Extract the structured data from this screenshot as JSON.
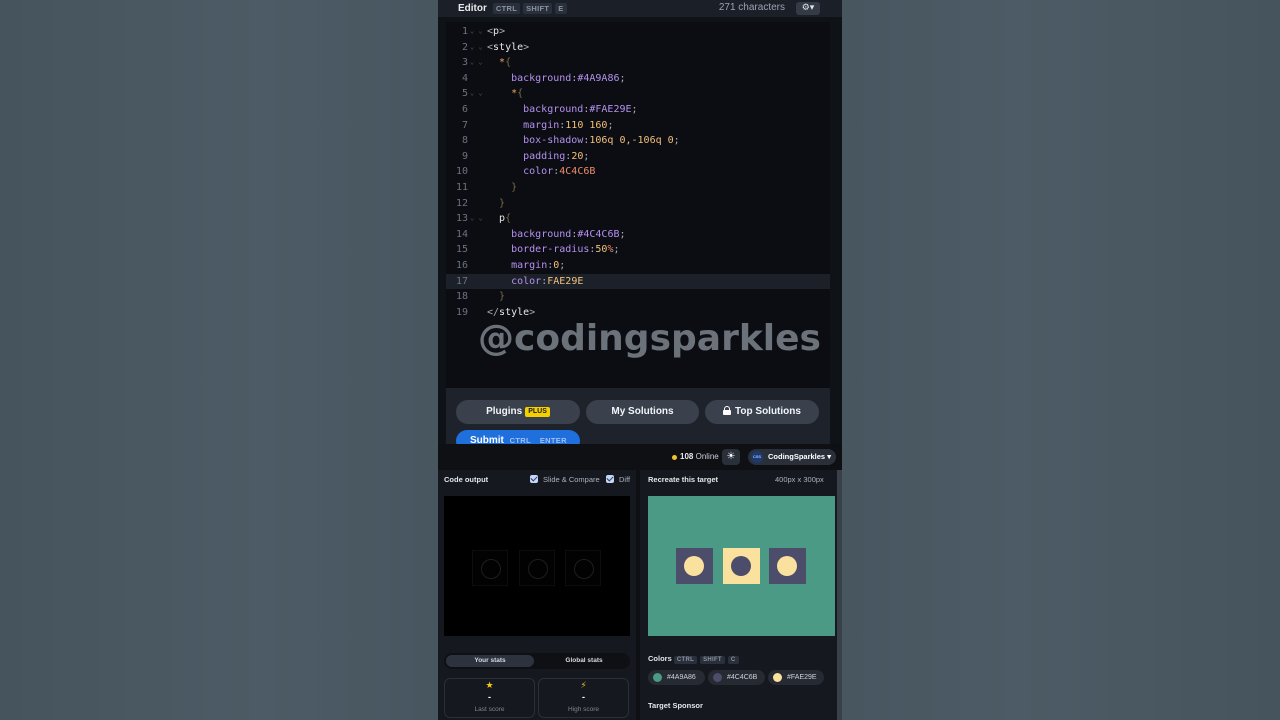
{
  "editor": {
    "title": "Editor",
    "shortcut": [
      "CTRL",
      "SHIFT",
      "E"
    ],
    "char_count": "271 characters",
    "settings_icon": "gear-icon"
  },
  "code_lines": [
    {
      "n": "1",
      "fold": true,
      "tokens": [
        {
          "c": "t-punc",
          "t": "<"
        },
        {
          "c": "t-tag",
          "t": "p"
        },
        {
          "c": "t-punc",
          "t": ">"
        }
      ]
    },
    {
      "n": "2",
      "fold": true,
      "tokens": [
        {
          "c": "t-punc",
          "t": "<"
        },
        {
          "c": "t-tag",
          "t": "style"
        },
        {
          "c": "t-punc",
          "t": ">"
        }
      ]
    },
    {
      "n": "3",
      "fold": true,
      "tokens": [
        {
          "c": "t-punc",
          "t": "  "
        },
        {
          "c": "t-sel",
          "t": "*"
        },
        {
          "c": "t-brace",
          "t": "{"
        }
      ]
    },
    {
      "n": "4",
      "fold": false,
      "tokens": [
        {
          "c": "t-punc",
          "t": "    "
        },
        {
          "c": "t-prop",
          "t": "background"
        },
        {
          "c": "t-punc",
          "t": ":"
        },
        {
          "c": "t-prop",
          "t": "#4A9A86"
        },
        {
          "c": "t-punc",
          "t": ";"
        }
      ]
    },
    {
      "n": "5",
      "fold": true,
      "tokens": [
        {
          "c": "t-punc",
          "t": "    "
        },
        {
          "c": "t-sel",
          "t": "*"
        },
        {
          "c": "t-brace",
          "t": "{"
        }
      ]
    },
    {
      "n": "6",
      "fold": false,
      "tokens": [
        {
          "c": "t-punc",
          "t": "      "
        },
        {
          "c": "t-prop",
          "t": "background"
        },
        {
          "c": "t-punc",
          "t": ":"
        },
        {
          "c": "t-prop",
          "t": "#FAE29E"
        },
        {
          "c": "t-punc",
          "t": ";"
        }
      ]
    },
    {
      "n": "7",
      "fold": false,
      "tokens": [
        {
          "c": "t-punc",
          "t": "      "
        },
        {
          "c": "t-prop",
          "t": "margin"
        },
        {
          "c": "t-punc",
          "t": ":"
        },
        {
          "c": "t-val",
          "t": "110 160"
        },
        {
          "c": "t-punc",
          "t": ";"
        }
      ]
    },
    {
      "n": "8",
      "fold": false,
      "tokens": [
        {
          "c": "t-punc",
          "t": "      "
        },
        {
          "c": "t-prop",
          "t": "box-shadow"
        },
        {
          "c": "t-punc",
          "t": ":"
        },
        {
          "c": "t-val",
          "t": "106q 0,-106q 0"
        },
        {
          "c": "t-punc",
          "t": ";"
        }
      ]
    },
    {
      "n": "9",
      "fold": false,
      "tokens": [
        {
          "c": "t-punc",
          "t": "      "
        },
        {
          "c": "t-prop",
          "t": "padding"
        },
        {
          "c": "t-punc",
          "t": ":"
        },
        {
          "c": "t-val",
          "t": "20"
        },
        {
          "c": "t-punc",
          "t": ";"
        }
      ]
    },
    {
      "n": "10",
      "fold": false,
      "tokens": [
        {
          "c": "t-punc",
          "t": "      "
        },
        {
          "c": "t-prop",
          "t": "color"
        },
        {
          "c": "t-punc",
          "t": ":"
        },
        {
          "c": "t-pct",
          "t": "4C4C6B"
        }
      ]
    },
    {
      "n": "11",
      "fold": false,
      "tokens": [
        {
          "c": "t-punc",
          "t": "    "
        },
        {
          "c": "t-brace",
          "t": "}"
        }
      ]
    },
    {
      "n": "12",
      "fold": false,
      "tokens": [
        {
          "c": "t-punc",
          "t": "  "
        },
        {
          "c": "t-brace",
          "t": "}"
        }
      ]
    },
    {
      "n": "13",
      "fold": true,
      "tokens": [
        {
          "c": "t-punc",
          "t": "  "
        },
        {
          "c": "t-tag",
          "t": "p"
        },
        {
          "c": "t-brace",
          "t": "{"
        }
      ]
    },
    {
      "n": "14",
      "fold": false,
      "tokens": [
        {
          "c": "t-punc",
          "t": "    "
        },
        {
          "c": "t-prop",
          "t": "background"
        },
        {
          "c": "t-punc",
          "t": ":"
        },
        {
          "c": "t-prop",
          "t": "#4C4C6B"
        },
        {
          "c": "t-punc",
          "t": ";"
        }
      ]
    },
    {
      "n": "15",
      "fold": false,
      "tokens": [
        {
          "c": "t-punc",
          "t": "    "
        },
        {
          "c": "t-prop",
          "t": "border-radius"
        },
        {
          "c": "t-punc",
          "t": ":"
        },
        {
          "c": "t-val",
          "t": "50"
        },
        {
          "c": "t-pct",
          "t": "%"
        },
        {
          "c": "t-punc",
          "t": ";"
        }
      ]
    },
    {
      "n": "16",
      "fold": false,
      "tokens": [
        {
          "c": "t-punc",
          "t": "    "
        },
        {
          "c": "t-prop",
          "t": "margin"
        },
        {
          "c": "t-punc",
          "t": ":"
        },
        {
          "c": "t-val",
          "t": "0"
        },
        {
          "c": "t-punc",
          "t": ";"
        }
      ]
    },
    {
      "n": "17",
      "fold": false,
      "active": true,
      "tokens": [
        {
          "c": "t-punc",
          "t": "    "
        },
        {
          "c": "t-prop",
          "t": "color"
        },
        {
          "c": "t-punc",
          "t": ":"
        },
        {
          "c": "t-val",
          "t": "FAE29E"
        }
      ]
    },
    {
      "n": "18",
      "fold": false,
      "tokens": [
        {
          "c": "t-punc",
          "t": "  "
        },
        {
          "c": "t-brace",
          "t": "}"
        }
      ]
    },
    {
      "n": "19",
      "fold": false,
      "tokens": [
        {
          "c": "t-punc",
          "t": "</"
        },
        {
          "c": "t-tag",
          "t": "style"
        },
        {
          "c": "t-punc",
          "t": ">"
        }
      ]
    }
  ],
  "watermark": "@codingsparkles",
  "buttons": {
    "plugins": "Plugins",
    "plus_badge": "PLUS",
    "my_solutions": "My Solutions",
    "top_solutions": "Top Solutions",
    "submit": "Submit",
    "submit_shortcut": [
      "CTRL",
      "ENTER"
    ]
  },
  "topbar": {
    "online_count": "108",
    "online_label": "Online",
    "theme_icon": "sun-icon",
    "username": "CodingSparkles",
    "avatar_text": "CSS"
  },
  "output_panel": {
    "title": "Code output",
    "slide_compare": "Slide & Compare",
    "diff": "Diff"
  },
  "target_panel": {
    "title": "Recreate this target",
    "size": "400px x 300px"
  },
  "stats": {
    "tab_your": "Your stats",
    "tab_global": "Global stats",
    "last_score_label": "Last score",
    "last_score_value": "-",
    "high_score_label": "High score",
    "high_score_value": "-"
  },
  "colors": {
    "title": "Colors",
    "shortcut": [
      "CTRL",
      "SHIFT",
      "C"
    ],
    "swatches": [
      "#4A9A86",
      "#4C4C6B",
      "#FAE29E"
    ]
  },
  "sponsor": "Target Sponsor",
  "palette": {
    "green": "#4a9a86",
    "navy": "#4c4c6b",
    "yellow": "#fae29e"
  }
}
